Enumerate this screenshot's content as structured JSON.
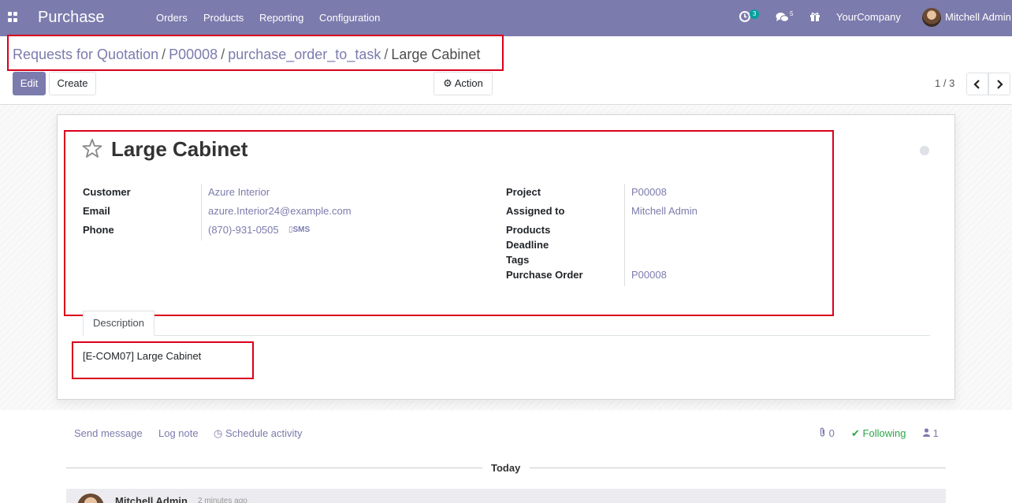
{
  "navbar": {
    "app_name": "Purchase",
    "menu": [
      "Orders",
      "Products",
      "Reporting",
      "Configuration"
    ],
    "activity_count": "3",
    "message_count": "5",
    "company": "YourCompany",
    "user": "Mitchell Admin"
  },
  "breadcrumb": [
    "Requests for Quotation",
    "P00008",
    "purchase_order_to_task",
    "Large Cabinet"
  ],
  "buttons": {
    "edit": "Edit",
    "create": "Create",
    "action": "Action"
  },
  "pager": "1 / 3",
  "record": {
    "title": "Large Cabinet",
    "fields_left": [
      {
        "label": "Customer",
        "value": "Azure Interior"
      },
      {
        "label": "Email",
        "value": "azure.Interior24@example.com"
      },
      {
        "label": "Phone",
        "value": "(870)-931-0505"
      }
    ],
    "sms_label": "SMS",
    "fields_right": [
      {
        "label": "Project",
        "value": "P00008"
      },
      {
        "label": "Assigned to",
        "value": "Mitchell Admin"
      },
      {
        "label": "Products",
        "value": ""
      },
      {
        "label": "Deadline",
        "value": ""
      },
      {
        "label": "Tags",
        "value": ""
      },
      {
        "label": "Purchase Order",
        "value": "P00008"
      }
    ]
  },
  "tabs": {
    "description": "Description"
  },
  "description": "[E-COM07] Large Cabinet",
  "chatter": {
    "send_message": "Send message",
    "log_note": "Log note",
    "schedule_activity": "Schedule activity",
    "attachments": "0",
    "following": "Following",
    "followers": "1",
    "today": "Today",
    "author": "Mitchell Admin",
    "time": "2 minutes ago"
  },
  "colors": {
    "brand": "#7c7bad",
    "highlight": "#d9001b",
    "following": "#28a745"
  }
}
